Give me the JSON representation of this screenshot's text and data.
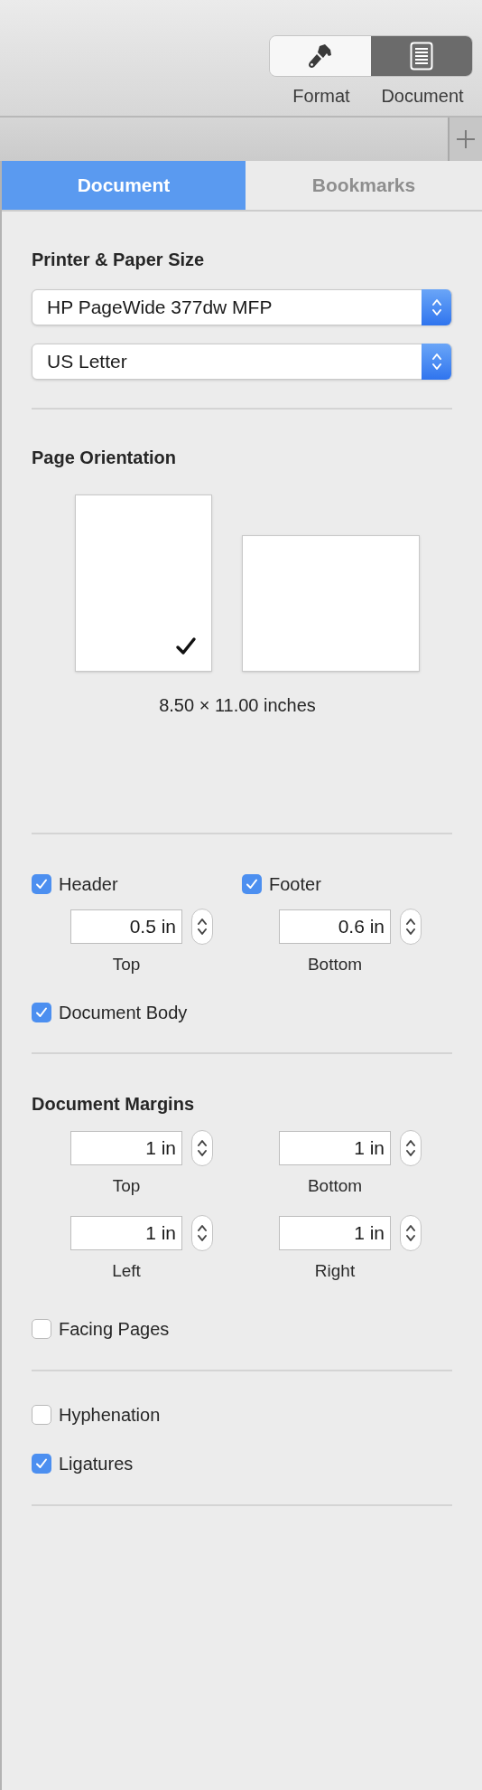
{
  "toolbar": {
    "segments": [
      {
        "kind": "format",
        "label": "Format",
        "selected": false
      },
      {
        "kind": "document",
        "label": "Document",
        "selected": true
      }
    ]
  },
  "tabs": [
    {
      "label": "Document",
      "selected": true
    },
    {
      "label": "Bookmarks",
      "selected": false
    }
  ],
  "printer_section": {
    "title": "Printer & Paper Size",
    "printer": "HP PageWide 377dw MFP",
    "paper_size": "US Letter"
  },
  "orientation": {
    "title": "Page Orientation",
    "options": [
      {
        "kind": "portrait",
        "selected": true
      },
      {
        "kind": "landscape",
        "selected": false
      }
    ],
    "dimensions": "8.50 × 11.00 inches"
  },
  "header_footer": {
    "items": [
      {
        "label": "Header",
        "checked": true,
        "value": "0.5 in",
        "caption": "Top"
      },
      {
        "label": "Footer",
        "checked": true,
        "value": "0.6 in",
        "caption": "Bottom"
      }
    ],
    "document_body": {
      "label": "Document Body",
      "checked": true
    }
  },
  "margins": {
    "title": "Document Margins",
    "fields": [
      {
        "value": "1 in",
        "caption": "Top"
      },
      {
        "value": "1 in",
        "caption": "Bottom"
      },
      {
        "value": "1 in",
        "caption": "Left"
      },
      {
        "value": "1 in",
        "caption": "Right"
      }
    ],
    "facing_pages": {
      "label": "Facing Pages",
      "checked": false
    }
  },
  "typography": [
    {
      "label": "Hyphenation",
      "checked": false
    },
    {
      "label": "Ligatures",
      "checked": true
    }
  ]
}
